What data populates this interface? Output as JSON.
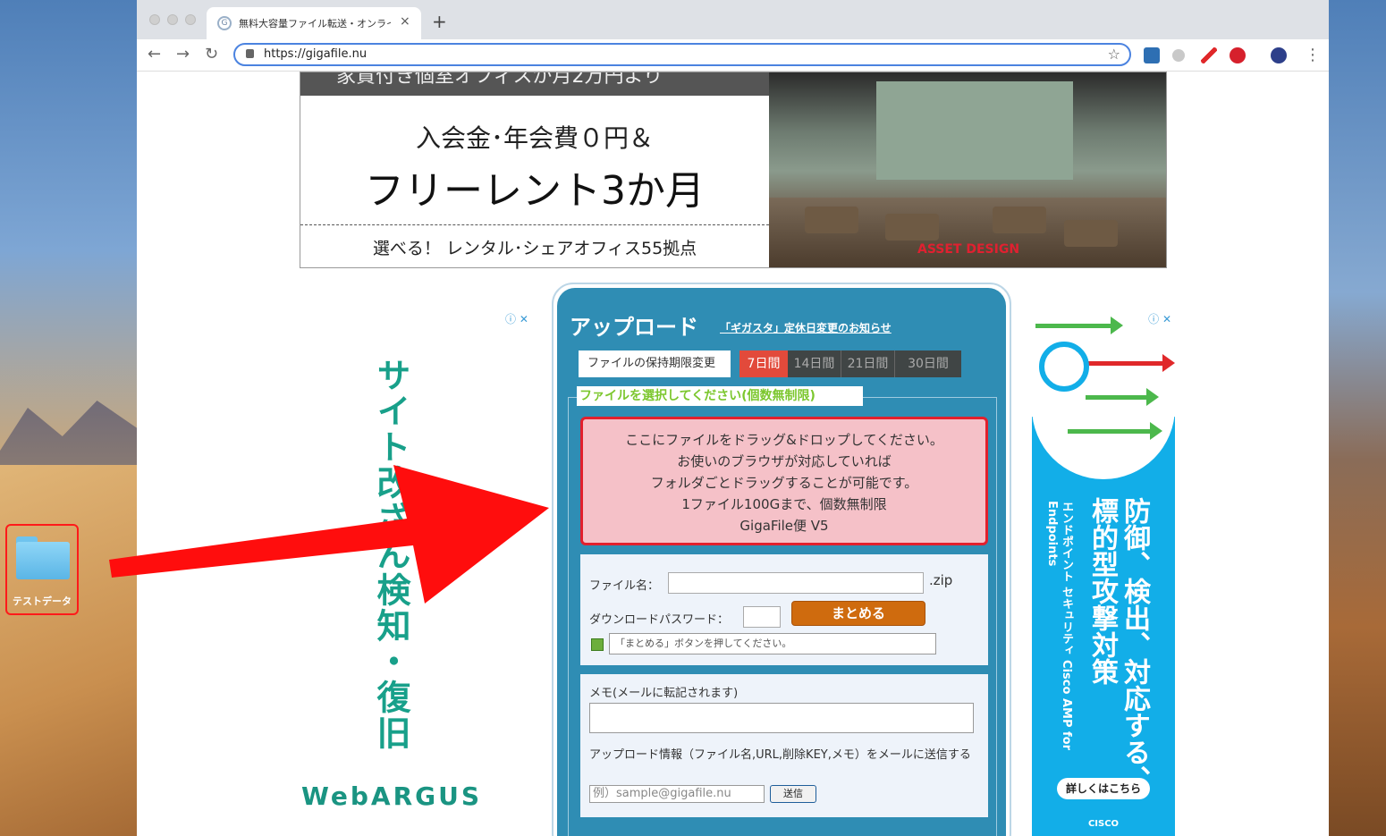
{
  "desktop": {
    "folder_label": "テストデータ"
  },
  "browser": {
    "tab_title": "無料大容量ファイル転送・オンライン",
    "tab_close": "×",
    "new_tab": "+",
    "url": "https://gigafile.nu",
    "back": "←",
    "forward": "→",
    "reload": "↻",
    "star": "☆",
    "menu": "⋮"
  },
  "banner": {
    "strip_text": "家賃付き個室オフィスが月2万円より",
    "line1": "入会金･年会費０円＆",
    "line2": "フリーレント3か月",
    "line3": "選べる！ レンタル･シェアオフィス55拠点",
    "photo_logo": "ASSET DESIGN"
  },
  "ad_left": {
    "icons": "ⓘ ✕",
    "vertical_text": "サイト改ざん検知・復旧",
    "logo": "WebARGUS"
  },
  "upload": {
    "title": "アップロード",
    "notice_link": "「ギガスタ」定休日変更のお知らせ",
    "retention_label": "ファイルの保持期限変更",
    "retention_options": [
      "7日間",
      "14日間",
      "21日間",
      "30日間"
    ],
    "retention_selected": "7日間",
    "select_legend": "ファイルを選択してください(個数無制限)",
    "dropzone_lines": [
      "ここにファイルをドラッグ&ドロップしてください。",
      "お使いのブラウザが対応していれば",
      "フォルダごとドラッグすることが可能です。",
      "1ファイル100Gまで、個数無制限",
      "GigaFile便 V5"
    ],
    "filename_label": "ファイル名：",
    "filename_value": "",
    "zip_suffix": ".zip",
    "password_label": "ダウンロードパスワード：",
    "password_value": "",
    "matome_button": "まとめる",
    "status_text": "「まとめる」ボタンを押してください。",
    "memo_label": "メモ(メールに転記されます)",
    "memo_value": "",
    "info_text": "アップロード情報（ファイル名,URL,削除KEY,メモ）をメールに送信する",
    "email_placeholder": "例）sample@gigafile.nu",
    "send_button": "送信"
  },
  "ad_right": {
    "icons": "ⓘ ✕",
    "headline": "防御、検出、対応する、標的型攻撃対策",
    "subline": "エンドポイント セキュリティ Cisco AMP for Endpoints",
    "cta": "詳しくはこちら",
    "brand": "CISCO"
  },
  "colors": {
    "panel_blue": "#2f8db4",
    "drop_pink": "#f5c1c8",
    "drop_border": "#e2202d",
    "selected_red": "#e24a3b",
    "matome_orange": "#cf6b0e",
    "legend_green": "#7cc72e",
    "ad_right_blue": "#12aee8",
    "webargus_green": "#18a08a"
  }
}
